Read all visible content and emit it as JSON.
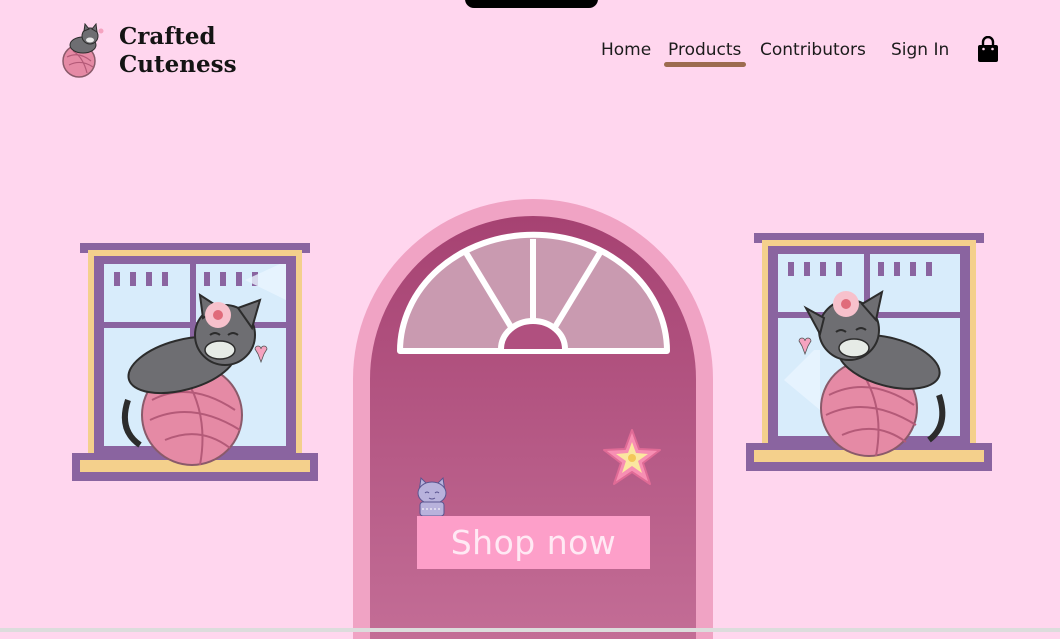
{
  "brand": {
    "name": "Crafted Cuteness",
    "logo_icon": "cat-on-yarn-logo-icon"
  },
  "nav": {
    "items": [
      {
        "label": "Home",
        "active": false
      },
      {
        "label": "Products",
        "active": true
      },
      {
        "label": "Contributors",
        "active": false
      },
      {
        "label": "Sign In",
        "active": false
      }
    ],
    "cart_icon": "shopping-bag-icon"
  },
  "hero": {
    "cta_label": "Shop now",
    "colors": {
      "background": "#ffd6ee",
      "door": "#b0507f",
      "door_frame": "#f0a3c4",
      "cta": "#fd9fc9",
      "active_underline": "#9c6b4f"
    }
  }
}
